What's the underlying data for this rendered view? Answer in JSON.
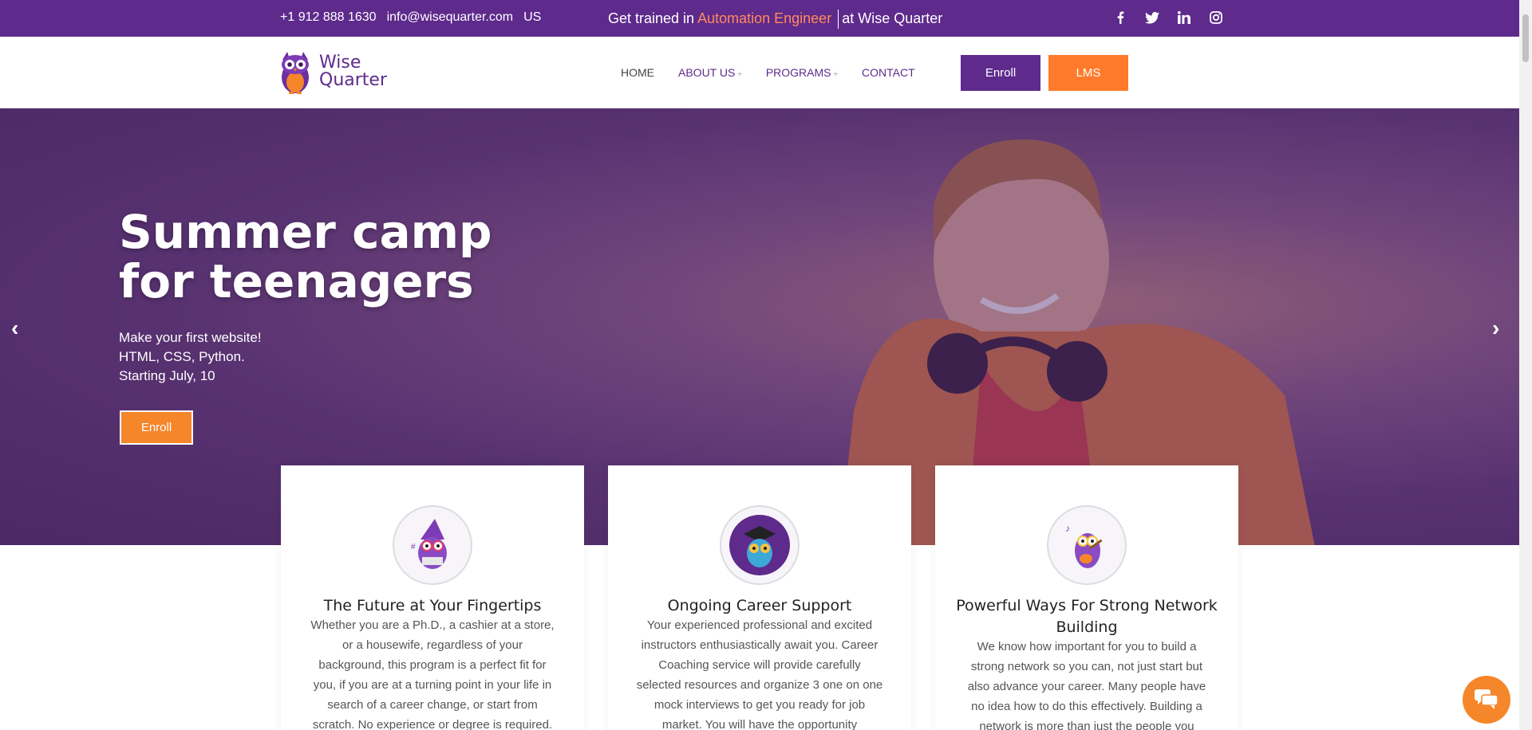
{
  "topbar": {
    "phone": "+1 912 888 1630",
    "email": "info@wisequarter.com",
    "region": "US",
    "promo_prefix": "Get trained in",
    "promo_highlight": "Automation Engineer",
    "promo_suffix": "at Wise Quarter",
    "social_icons": [
      "facebook-icon",
      "twitter-icon",
      "linkedin-icon",
      "instagram-icon"
    ]
  },
  "header": {
    "logo_line1": "Wise",
    "logo_line2": "Quarter",
    "nav": {
      "home": "HOME",
      "about": "ABOUT US",
      "programs": "PROGRAMS",
      "contact": "CONTACT"
    },
    "enroll_label": "Enroll",
    "lms_label": "LMS"
  },
  "hero": {
    "title_line1": "Summer camp",
    "title_line2": "for teenagers",
    "sub_line1": "Make your first website!",
    "sub_line2": "HTML, CSS, Python.",
    "sub_line3": "Starting July, 10",
    "button_label": "Enroll"
  },
  "cards": [
    {
      "title": "The Future at Your Fingertips",
      "text": "Whether you are a Ph.D., a cashier at a store, or a housewife, regardless of your background, this program is a perfect fit for you, if you are at a turning point in your life in search of a career change, or start from scratch. No experience or degree is required."
    },
    {
      "title": "Ongoing Career Support",
      "text": "Your experienced professional and excited instructors enthusiastically await you. Career Coaching service will provide carefully selected resources and organize 3 one on one mock interviews to get you ready for job market. You will have the opportunity"
    },
    {
      "title": "Powerful Ways For Strong Network Building",
      "text": "We know how important for you to build a strong network so you can, not just start but also advance your career. Many people have no idea how to do this effectively. Building a network is more than just the people you"
    }
  ],
  "colors": {
    "brand_purple": "#5e2a8c",
    "accent_orange": "#ff7a2a",
    "promo_highlight": "#ff8a5b"
  }
}
